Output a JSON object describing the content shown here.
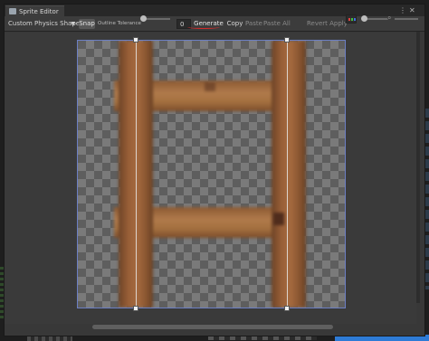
{
  "window": {
    "title": "Sprite Editor"
  },
  "toolbar": {
    "mode_dropdown": "Custom Physics Shape",
    "snap_label": "Snap",
    "outline_tolerance_label": "Outline Tolerance",
    "outline_tolerance_value": "0",
    "generate_label": "Generate",
    "copy_label": "Copy",
    "paste_label": "Paste",
    "paste_all_label": "Paste All",
    "revert_label": "Revert",
    "apply_label": "Apply"
  },
  "icons": [
    "sprite-editor-icon",
    "more-menu-icon",
    "close-icon",
    "chevron-down-icon",
    "rgb-channel-icon",
    "zoom-icon"
  ],
  "colors": {
    "annotation_underline": "#d22a2a",
    "sprite_outline": "#6c7fc4",
    "wood": "#a56a3f",
    "selection_blue": "#2e7bd6"
  }
}
